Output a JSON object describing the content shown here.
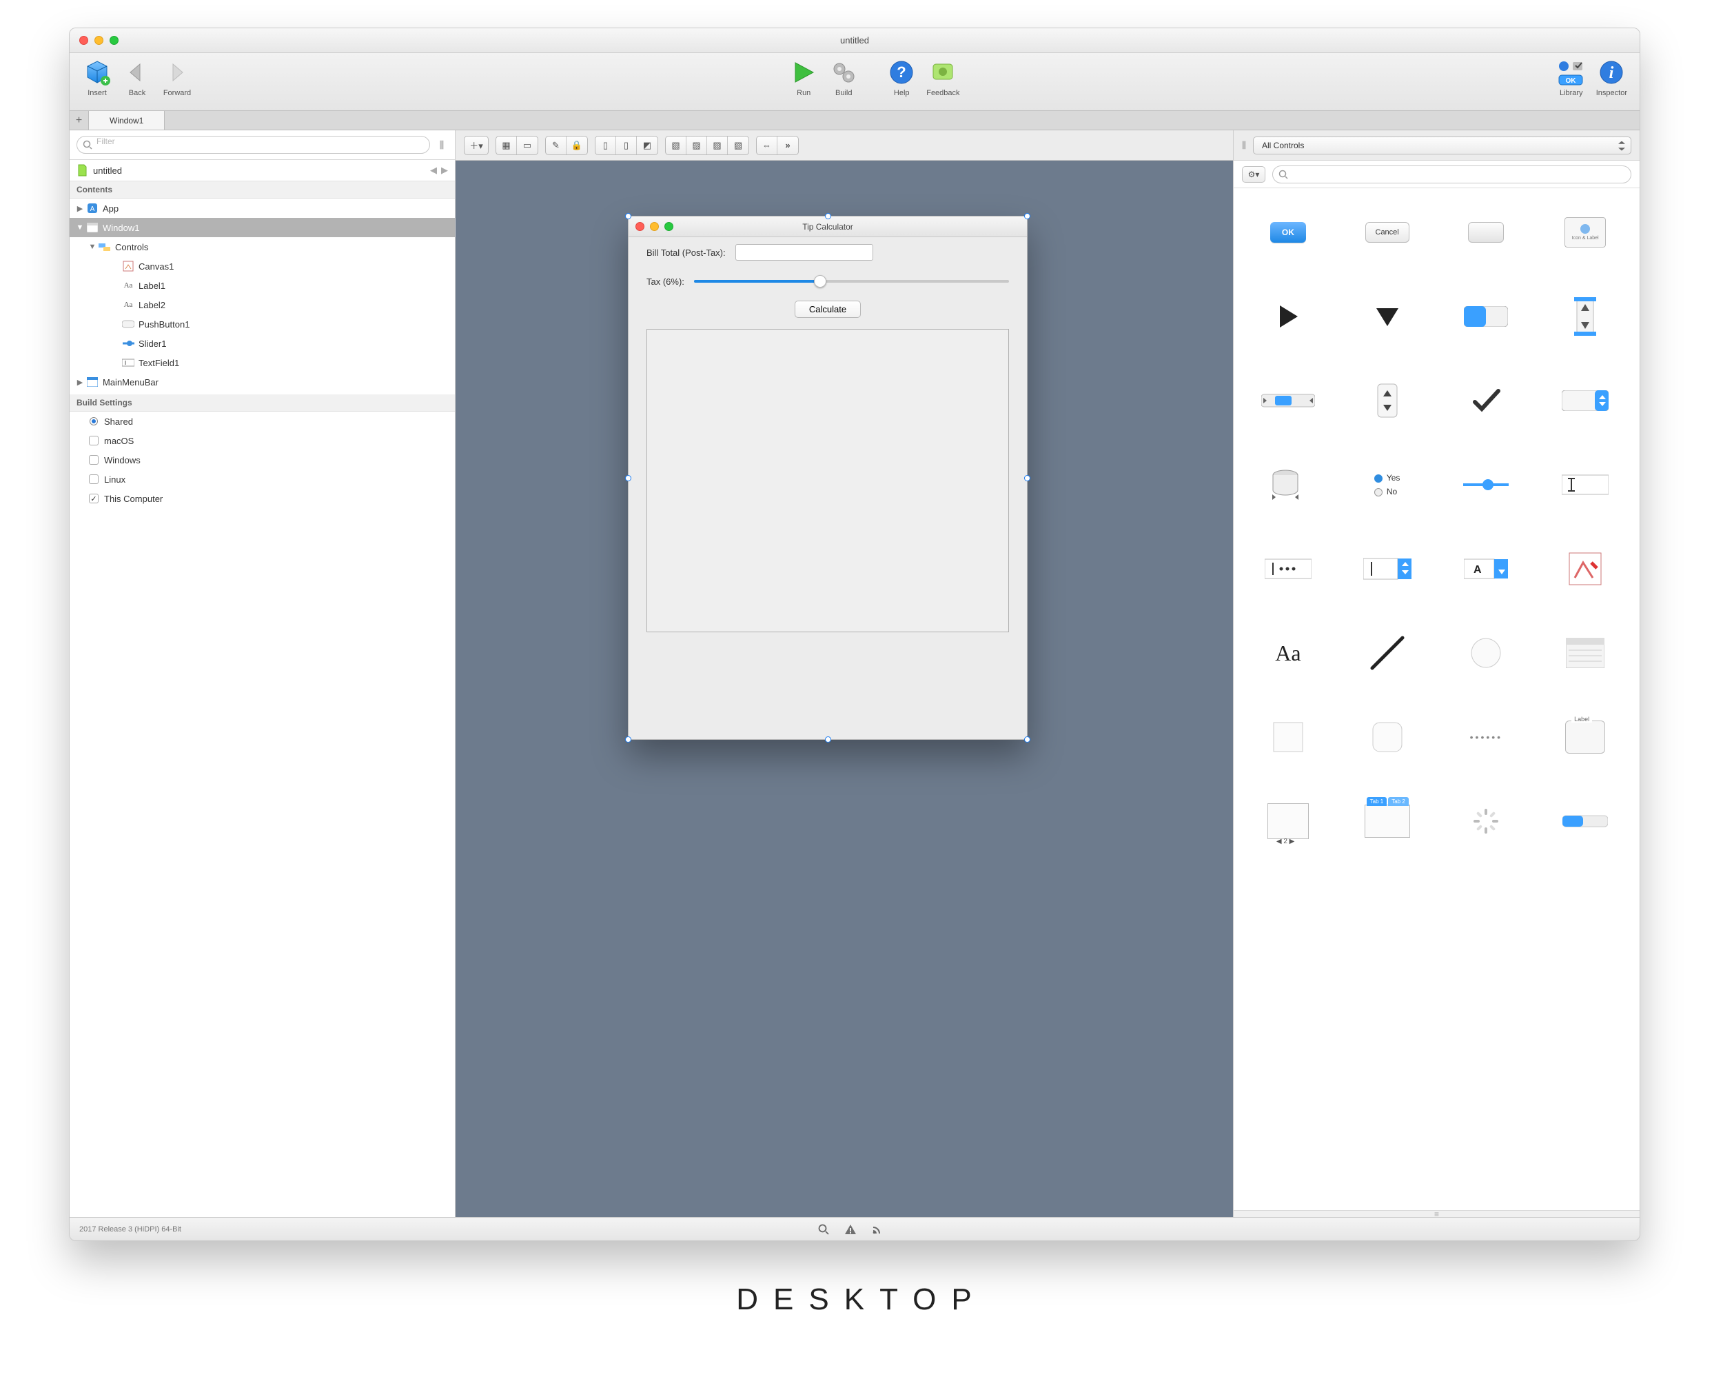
{
  "window_title": "untitled",
  "toolbar": {
    "insert": "Insert",
    "back": "Back",
    "forward": "Forward",
    "run": "Run",
    "build": "Build",
    "help": "Help",
    "feedback": "Feedback",
    "library": "Library",
    "inspector": "Inspector"
  },
  "tabs": {
    "tab1": "Window1"
  },
  "sidebar": {
    "filter_placeholder": "Filter",
    "project_name": "untitled",
    "contents_label": "Contents",
    "items": {
      "app": "App",
      "window1": "Window1",
      "controls": "Controls",
      "canvas1": "Canvas1",
      "label1": "Label1",
      "label2": "Label2",
      "pushbutton1": "PushButton1",
      "slider1": "Slider1",
      "textfield1": "TextField1",
      "mainmenubar": "MainMenuBar"
    },
    "build_settings_label": "Build Settings",
    "build": {
      "shared": "Shared",
      "macos": "macOS",
      "windows": "Windows",
      "linux": "Linux",
      "this_computer": "This Computer"
    }
  },
  "designer": {
    "title": "Tip Calculator",
    "bill_label": "Bill Total (Post-Tax):",
    "tax_label": "Tax (6%):",
    "calc_label": "Calculate",
    "slider_percent": 40
  },
  "library": {
    "selector": "All Controls",
    "search_placeholder": "",
    "items": {
      "ok": "OK",
      "cancel": "Cancel",
      "iconlabel": "Icon & Label",
      "yes": "Yes",
      "no": "No",
      "aa": "Aa",
      "a": "A",
      "label": "Label",
      "tab1": "Tab 1",
      "tab2": "Tab 2",
      "page": "2"
    }
  },
  "status": {
    "version": "2017 Release 3 (HiDPI) 64-Bit"
  },
  "caption": "DESKTOP"
}
